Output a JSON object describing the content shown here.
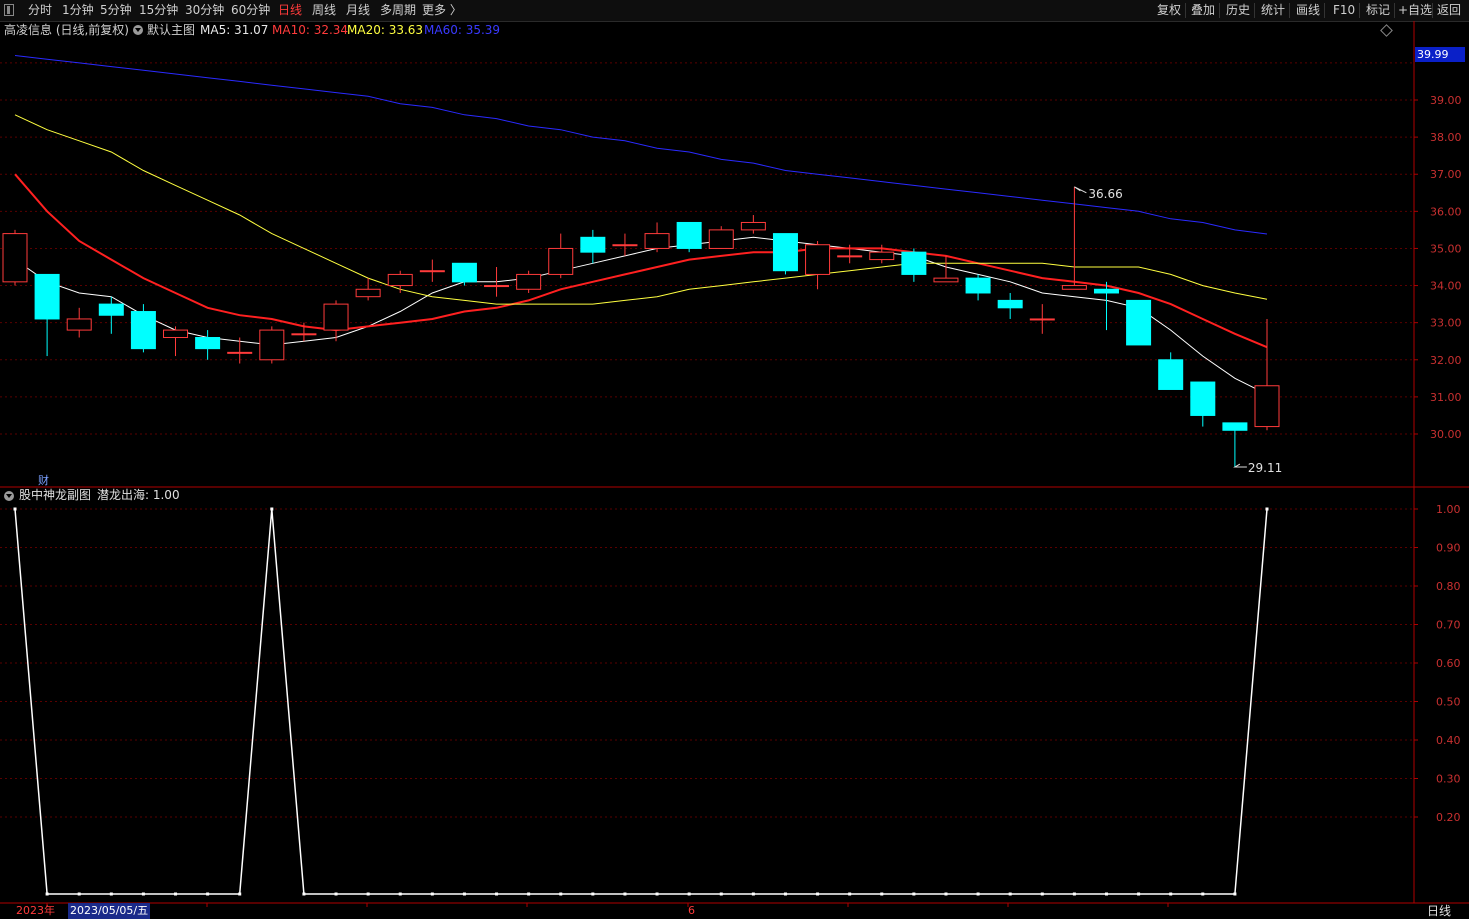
{
  "toolbar": {
    "periods": [
      "分时",
      "1分钟",
      "5分钟",
      "15分钟",
      "30分钟",
      "60分钟",
      "日线",
      "周线",
      "月线",
      "多周期",
      "更多 〉"
    ],
    "active_index": 6,
    "actions": [
      "复权",
      "叠加",
      "历史",
      "统计",
      "画线",
      "F10",
      "标记",
      "+自选",
      "返回"
    ]
  },
  "main_chart": {
    "stock_label": "高凌信息 (日线,前复权)",
    "template_label": "默认主图",
    "ma5": "MA5: 31.07",
    "ma10": "MA10: 32.34",
    "ma20": "MA20: 33.63",
    "ma60": "MA60: 35.39",
    "current_price": "39.99",
    "high_annotation": "36.66",
    "low_annotation": "29.11",
    "fin_marker": "财",
    "price_ticks": [
      "39.00",
      "38.00",
      "37.00",
      "36.00",
      "35.00",
      "34.00",
      "33.00",
      "32.00",
      "31.00",
      "30.00"
    ]
  },
  "sub_chart": {
    "title": "股中神龙副图",
    "indicator": "潜龙出海: 1.00",
    "ticks": [
      "1.00",
      "0.90",
      "0.80",
      "0.70",
      "0.60",
      "0.50",
      "0.40",
      "0.30",
      "0.20"
    ]
  },
  "footer": {
    "year": "2023年",
    "date": "2023/05/05/五",
    "month": "6",
    "period": "日线"
  },
  "colors": {
    "up": "#ff3b3b",
    "down": "#00ffff",
    "ma5": "#ffffff",
    "ma10": "#ff2020",
    "ma20": "#ffff40",
    "ma60": "#2a2aff",
    "grid": "#5a0000"
  },
  "chart_data": [
    {
      "type": "candlestick",
      "yaxis_range": [
        29.0,
        40.5
      ],
      "candles": [
        {
          "o": 34.1,
          "c": 35.4,
          "h": 35.5,
          "l": 34.0
        },
        {
          "o": 34.3,
          "c": 33.1,
          "h": 34.3,
          "l": 32.1
        },
        {
          "o": 32.8,
          "c": 33.1,
          "h": 33.4,
          "l": 32.6
        },
        {
          "o": 33.5,
          "c": 33.2,
          "h": 33.7,
          "l": 32.7
        },
        {
          "o": 33.3,
          "c": 32.3,
          "h": 33.5,
          "l": 32.2
        },
        {
          "o": 32.6,
          "c": 32.8,
          "h": 32.9,
          "l": 32.1
        },
        {
          "o": 32.6,
          "c": 32.3,
          "h": 32.8,
          "l": 32.0
        },
        {
          "o": 32.2,
          "c": 32.2,
          "h": 32.6,
          "l": 31.9
        },
        {
          "o": 32.0,
          "c": 32.8,
          "h": 32.9,
          "l": 31.9
        },
        {
          "o": 32.7,
          "c": 32.7,
          "h": 33.0,
          "l": 32.5
        },
        {
          "o": 32.8,
          "c": 33.5,
          "h": 33.6,
          "l": 32.5
        },
        {
          "o": 33.7,
          "c": 33.9,
          "h": 34.2,
          "l": 33.6
        },
        {
          "o": 34.0,
          "c": 34.3,
          "h": 34.4,
          "l": 33.8
        },
        {
          "o": 34.4,
          "c": 34.4,
          "h": 34.7,
          "l": 34.1
        },
        {
          "o": 34.6,
          "c": 34.1,
          "h": 34.6,
          "l": 34.0
        },
        {
          "o": 34.0,
          "c": 34.0,
          "h": 34.5,
          "l": 33.7
        },
        {
          "o": 33.9,
          "c": 34.3,
          "h": 34.4,
          "l": 33.8
        },
        {
          "o": 34.3,
          "c": 35.0,
          "h": 35.4,
          "l": 34.2
        },
        {
          "o": 35.3,
          "c": 34.9,
          "h": 35.5,
          "l": 34.6
        },
        {
          "o": 35.1,
          "c": 35.1,
          "h": 35.4,
          "l": 34.8
        },
        {
          "o": 35.0,
          "c": 35.4,
          "h": 35.7,
          "l": 34.9
        },
        {
          "o": 35.7,
          "c": 35.0,
          "h": 35.7,
          "l": 34.9
        },
        {
          "o": 35.0,
          "c": 35.5,
          "h": 35.6,
          "l": 35.0
        },
        {
          "o": 35.5,
          "c": 35.7,
          "h": 35.9,
          "l": 35.4
        },
        {
          "o": 35.4,
          "c": 34.4,
          "h": 35.4,
          "l": 34.3
        },
        {
          "o": 34.3,
          "c": 35.1,
          "h": 35.2,
          "l": 33.9
        },
        {
          "o": 34.8,
          "c": 34.8,
          "h": 35.1,
          "l": 34.6
        },
        {
          "o": 34.7,
          "c": 34.9,
          "h": 35.1,
          "l": 34.6
        },
        {
          "o": 34.9,
          "c": 34.3,
          "h": 35.0,
          "l": 34.1
        },
        {
          "o": 34.1,
          "c": 34.2,
          "h": 34.8,
          "l": 34.1
        },
        {
          "o": 34.2,
          "c": 33.8,
          "h": 34.3,
          "l": 33.6
        },
        {
          "o": 33.6,
          "c": 33.4,
          "h": 33.8,
          "l": 33.1
        },
        {
          "o": 33.1,
          "c": 33.1,
          "h": 33.5,
          "l": 32.7
        },
        {
          "o": 33.9,
          "c": 34.0,
          "h": 36.66,
          "l": 33.9
        },
        {
          "o": 33.9,
          "c": 33.8,
          "h": 34.1,
          "l": 32.8
        },
        {
          "o": 33.6,
          "c": 32.4,
          "h": 33.6,
          "l": 32.4
        },
        {
          "o": 32.0,
          "c": 31.2,
          "h": 32.2,
          "l": 31.2
        },
        {
          "o": 31.4,
          "c": 30.5,
          "h": 31.4,
          "l": 30.2
        },
        {
          "o": 30.3,
          "c": 30.1,
          "h": 30.3,
          "l": 29.11
        },
        {
          "o": 30.2,
          "c": 31.3,
          "h": 33.1,
          "l": 30.1
        }
      ],
      "series": [
        {
          "name": "MA5",
          "values": [
            34.7,
            34.1,
            33.8,
            33.7,
            33.2,
            32.8,
            32.6,
            32.5,
            32.4,
            32.5,
            32.6,
            32.9,
            33.3,
            33.8,
            34.1,
            34.1,
            34.2,
            34.4,
            34.6,
            34.8,
            35.0,
            35.1,
            35.2,
            35.3,
            35.2,
            35.1,
            35.0,
            34.9,
            34.8,
            34.5,
            34.3,
            34.1,
            33.8,
            33.7,
            33.6,
            33.4,
            32.8,
            32.1,
            31.5,
            31.07
          ]
        },
        {
          "name": "MA10",
          "values": [
            37.0,
            36.0,
            35.2,
            34.7,
            34.2,
            33.8,
            33.4,
            33.2,
            33.1,
            32.9,
            32.8,
            32.9,
            33.0,
            33.1,
            33.3,
            33.4,
            33.6,
            33.9,
            34.1,
            34.3,
            34.5,
            34.7,
            34.8,
            34.9,
            34.9,
            35.0,
            35.0,
            35.0,
            34.9,
            34.8,
            34.6,
            34.4,
            34.2,
            34.1,
            34.0,
            33.8,
            33.5,
            33.1,
            32.7,
            32.34
          ]
        },
        {
          "name": "MA20",
          "values": [
            38.6,
            38.2,
            37.9,
            37.6,
            37.1,
            36.7,
            36.3,
            35.9,
            35.4,
            35.0,
            34.6,
            34.2,
            33.9,
            33.7,
            33.6,
            33.5,
            33.5,
            33.5,
            33.5,
            33.6,
            33.7,
            33.9,
            34.0,
            34.1,
            34.2,
            34.3,
            34.4,
            34.5,
            34.6,
            34.6,
            34.6,
            34.6,
            34.6,
            34.5,
            34.5,
            34.5,
            34.3,
            34.0,
            33.8,
            33.63
          ]
        },
        {
          "name": "MA60",
          "values": [
            40.2,
            40.1,
            40.0,
            39.9,
            39.8,
            39.7,
            39.6,
            39.5,
            39.4,
            39.3,
            39.2,
            39.1,
            38.9,
            38.8,
            38.6,
            38.5,
            38.3,
            38.2,
            38.0,
            37.9,
            37.7,
            37.6,
            37.4,
            37.3,
            37.1,
            37.0,
            36.9,
            36.8,
            36.7,
            36.6,
            36.5,
            36.4,
            36.3,
            36.2,
            36.1,
            36.0,
            35.8,
            35.7,
            35.5,
            35.39
          ]
        }
      ]
    },
    {
      "type": "line",
      "name": "潜龙出海",
      "yaxis_range": [
        0,
        1.0
      ],
      "values": [
        1,
        0,
        0,
        0,
        0,
        0,
        0,
        0,
        1,
        0,
        0,
        0,
        0,
        0,
        0,
        0,
        0,
        0,
        0,
        0,
        0,
        0,
        0,
        0,
        0,
        0,
        0,
        0,
        0,
        0,
        0,
        0,
        0,
        0,
        0,
        0,
        0,
        0,
        0,
        1
      ]
    }
  ]
}
